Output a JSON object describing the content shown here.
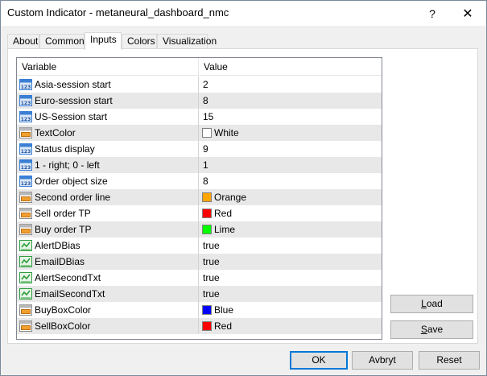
{
  "window": {
    "title": "Custom Indicator - metaneural_dashboard_nmc",
    "help": "?",
    "close": "✕"
  },
  "tabs": [
    {
      "label": "About"
    },
    {
      "label": "Common"
    },
    {
      "label": "Inputs"
    },
    {
      "label": "Colors"
    },
    {
      "label": "Visualization"
    }
  ],
  "active_tab": "Inputs",
  "grid": {
    "headers": {
      "variable": "Variable",
      "value": "Value"
    },
    "rows": [
      {
        "name": "Asia-session start",
        "type": "int",
        "value": "2"
      },
      {
        "name": "Euro-session start",
        "type": "int",
        "value": "8"
      },
      {
        "name": "US-Session start",
        "type": "int",
        "value": "15"
      },
      {
        "name": "TextColor",
        "type": "color",
        "value": "White",
        "color": "#ffffff"
      },
      {
        "name": "Status display",
        "type": "int",
        "value": "9"
      },
      {
        "name": "1 - right; 0 - left",
        "type": "int",
        "value": "1"
      },
      {
        "name": "Order object size",
        "type": "int",
        "value": "8"
      },
      {
        "name": "Second order line",
        "type": "color",
        "value": "Orange",
        "color": "#ffa500"
      },
      {
        "name": "Sell order TP",
        "type": "color",
        "value": "Red",
        "color": "#ff0000"
      },
      {
        "name": "Buy order TP",
        "type": "color",
        "value": "Lime",
        "color": "#00ff00"
      },
      {
        "name": "AlertDBias",
        "type": "bool",
        "value": "true"
      },
      {
        "name": "EmailDBias",
        "type": "bool",
        "value": "true"
      },
      {
        "name": "AlertSecondTxt",
        "type": "bool",
        "value": "true"
      },
      {
        "name": "EmailSecondTxt",
        "type": "bool",
        "value": "true"
      },
      {
        "name": "BuyBoxColor",
        "type": "color",
        "value": "Blue",
        "color": "#0000ff"
      },
      {
        "name": "SellBoxColor",
        "type": "color",
        "value": "Red",
        "color": "#ff0000"
      }
    ]
  },
  "buttons": {
    "load_first": "L",
    "load_rest": "oad",
    "save_first": "S",
    "save_rest": "ave",
    "ok": "OK",
    "cancel": "Avbryt",
    "reset": "Reset"
  },
  "colors": {
    "accent": "#0078d7",
    "int_icon": "#3b7fd4",
    "color_icon": "#f0a030",
    "bool_icon": "#2e9e3e"
  }
}
